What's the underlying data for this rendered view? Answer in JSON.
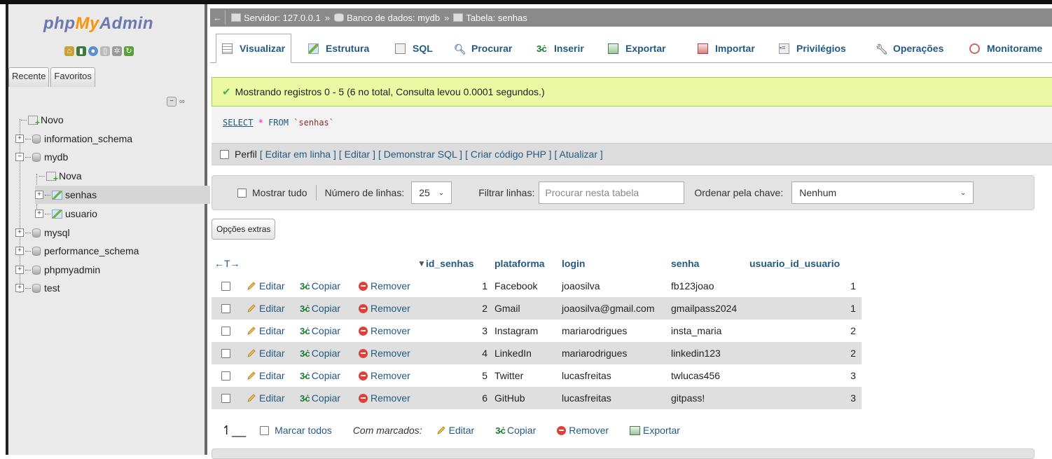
{
  "app": {
    "logo_php": "php",
    "logo_my": "My",
    "logo_admin": "Admin"
  },
  "nav": {
    "tabs": [
      "Recente",
      "Favoritos"
    ],
    "tree": [
      {
        "label": "Novo",
        "kind": "new"
      },
      {
        "label": "information_schema",
        "kind": "db"
      },
      {
        "label": "mydb",
        "kind": "db"
      },
      {
        "label": "Nova",
        "kind": "new"
      },
      {
        "label": "senhas",
        "kind": "table"
      },
      {
        "label": "usuario",
        "kind": "table"
      },
      {
        "label": "mysql",
        "kind": "db"
      },
      {
        "label": "performance_schema",
        "kind": "db"
      },
      {
        "label": "phpmyadmin",
        "kind": "db"
      },
      {
        "label": "test",
        "kind": "db"
      }
    ]
  },
  "breadcrumb": {
    "server": "Servidor: 127.0.0.1",
    "database": "Banco de dados: mydb",
    "table": "Tabela: senhas",
    "separator": "»"
  },
  "menu_tabs": [
    "Visualizar",
    "Estrutura",
    "SQL",
    "Procurar",
    "Inserir",
    "Exportar",
    "Importar",
    "Privilégios",
    "Operações",
    "Monitorame"
  ],
  "success_message": "Mostrando registros 0 - 5 (6 no total, Consulta levou 0.0001 segundos.)",
  "sql": {
    "select": "SELECT",
    "star": "*",
    "from": "FROM",
    "table": "`senhas`"
  },
  "profile": {
    "label": "Perfil",
    "links": [
      "[ Editar em linha ]",
      "[ Editar ]",
      "[ Demonstrar SQL ]",
      "[ Criar código PHP ]",
      "[ Atualizar ]"
    ]
  },
  "filter": {
    "show_all": "Mostrar tudo",
    "rows_label": "Número de linhas:",
    "rows_value": "25",
    "filter_label": "Filtrar linhas:",
    "filter_placeholder": "Procurar nesta tabela",
    "order_label": "Ordenar pela chave:",
    "order_value": "Nenhum"
  },
  "extras_button": "Opções extras",
  "table": {
    "nav_arrows": "←T→",
    "sort_arrow": "▼",
    "columns": [
      "id_senhas",
      "plataforma",
      "login",
      "senha",
      "usuario_id_usuario"
    ],
    "actions": {
      "edit": "Editar",
      "copy": "Copiar",
      "remove": "Remover"
    },
    "rows": [
      [
        "1",
        "Facebook",
        "joaosilva",
        "fb123joao",
        "1"
      ],
      [
        "2",
        "Gmail",
        "joaosilva@gmail.com",
        "gmailpass2024",
        "1"
      ],
      [
        "3",
        "Instagram",
        "mariarodrigues",
        "insta_maria",
        "2"
      ],
      [
        "4",
        "LinkedIn",
        "mariarodrigues",
        "linkedin123",
        "2"
      ],
      [
        "5",
        "Twitter",
        "lucasfreitas",
        "twlucas456",
        "3"
      ],
      [
        "6",
        "GitHub",
        "lucasfreitas",
        "gitpass!",
        "3"
      ]
    ]
  },
  "bulk": {
    "check_all": "Marcar todos",
    "with_selected": "Com marcados:",
    "edit": "Editar",
    "copy": "Copiar",
    "remove": "Remover",
    "export": "Exportar"
  }
}
